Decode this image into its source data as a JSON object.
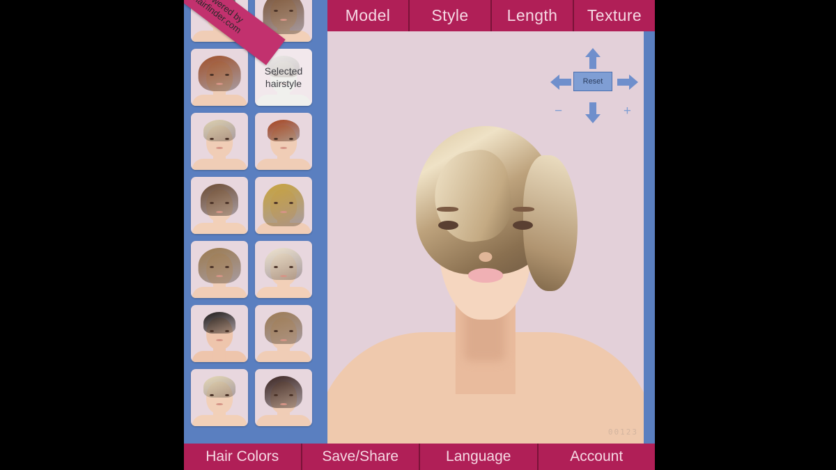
{
  "app": {
    "watermark": "00123",
    "ribbon": {
      "line1": "Powered by",
      "line2": "hairfinder.com"
    },
    "colors": {
      "magenta": "#b01f57",
      "magenta_dark": "#7a1338",
      "blue_frame": "#5a7fc0",
      "preview_bg": "#e3d0d9",
      "button_blue": "#7f9ed4"
    }
  },
  "top_nav": {
    "items": [
      {
        "label": "Model"
      },
      {
        "label": "Style"
      },
      {
        "label": "Length"
      },
      {
        "label": "Texture"
      }
    ]
  },
  "bottom_nav": {
    "items": [
      {
        "label": "Hair Colors"
      },
      {
        "label": "Save/Share"
      },
      {
        "label": "Language"
      },
      {
        "label": "Account"
      }
    ]
  },
  "controls": {
    "reset_label": "Reset",
    "up_icon": "arrow-up-icon",
    "down_icon": "arrow-down-icon",
    "left_icon": "arrow-left-icon",
    "right_icon": "arrow-right-icon",
    "zoom_out_label": "−",
    "zoom_in_label": "+"
  },
  "selected_thumb": {
    "label_line1": "Selected",
    "label_line2": "hairstyle"
  },
  "sidebar": {
    "thumbnails": [
      {
        "hair_color": "#2a2220",
        "hair_shape": "pixie",
        "skin": "#f0cdb6",
        "selected": false
      },
      {
        "hair_color": "#7a5336",
        "hair_shape": "long",
        "skin": "#f2d0b8",
        "selected": false
      },
      {
        "hair_color": "#a0502a",
        "hair_shape": "wavy",
        "skin": "#f0cdb6",
        "selected": false
      },
      {
        "hair_color": "#cdc3b4",
        "hair_shape": "pixie",
        "skin": "#f2d0b8",
        "selected": true
      },
      {
        "hair_color": "#ddd0ae",
        "hair_shape": "pixie",
        "skin": "#f0cdb6",
        "selected": false
      },
      {
        "hair_color": "#a8431c",
        "hair_shape": "pixie",
        "skin": "#f0cdb6",
        "selected": false
      },
      {
        "hair_color": "#6b4b33",
        "hair_shape": "bob",
        "skin": "#f2d0b8",
        "selected": false
      },
      {
        "hair_color": "#c9a43c",
        "hair_shape": "long",
        "skin": "#f0cdb6",
        "selected": false
      },
      {
        "hair_color": "#9b7a4e",
        "hair_shape": "wavy",
        "skin": "#f0cdb6",
        "selected": false
      },
      {
        "hair_color": "#efe4cf",
        "hair_shape": "bob",
        "skin": "#f2d0b8",
        "selected": false
      },
      {
        "hair_color": "#1d1a19",
        "hair_shape": "pixie",
        "skin": "#eec5ac",
        "selected": false
      },
      {
        "hair_color": "#9c7a52",
        "hair_shape": "bob",
        "skin": "#f0cdb6",
        "selected": false
      },
      {
        "hair_color": "#e6d9b6",
        "hair_shape": "pixie",
        "skin": "#f2d0b8",
        "selected": false
      },
      {
        "hair_color": "#3a2420",
        "hair_shape": "bob",
        "skin": "#f0cdb6",
        "selected": false
      }
    ]
  }
}
